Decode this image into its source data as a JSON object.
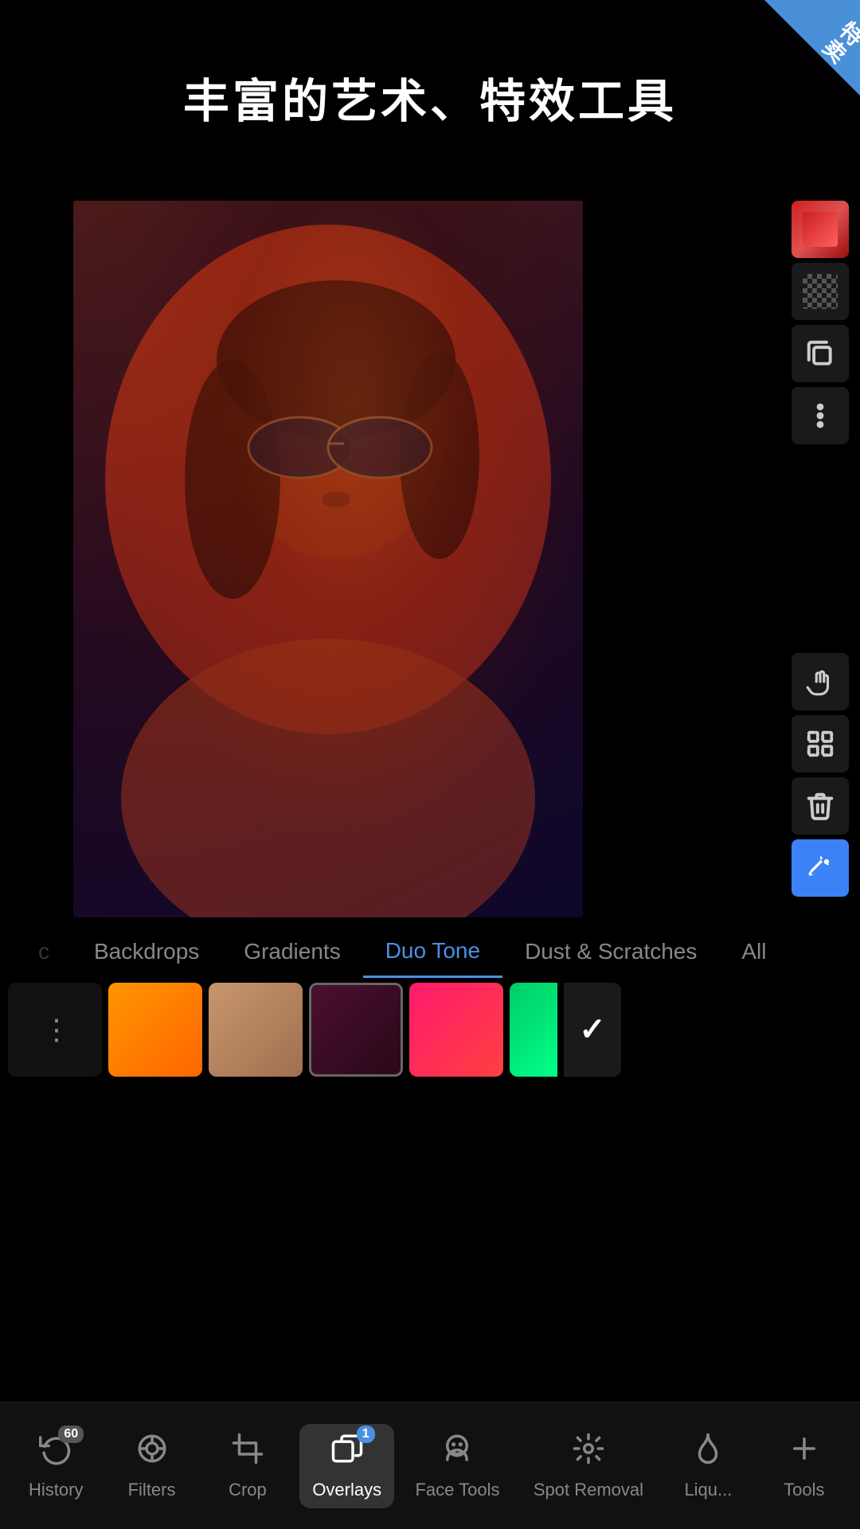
{
  "app": {
    "title": "丰富的艺术、特效工具",
    "corner_badge": "特卖"
  },
  "toolbar": {
    "color_swatch_label": "color swatch",
    "checkerboard_label": "checkerboard",
    "copy_label": "copy",
    "more_label": "more",
    "hand_label": "move",
    "select_label": "select",
    "delete_label": "delete",
    "eyedropper_label": "eyedropper"
  },
  "categories": {
    "items": [
      {
        "id": "backdrops",
        "label": "Backdrops",
        "active": false,
        "partial": false
      },
      {
        "id": "gradients",
        "label": "Gradients",
        "active": false,
        "partial": false
      },
      {
        "id": "duo-tone",
        "label": "Duo Tone",
        "active": true,
        "partial": false
      },
      {
        "id": "dust-scratches",
        "label": "Dust & Scratches",
        "active": false,
        "partial": false
      },
      {
        "id": "all",
        "label": "All",
        "active": false,
        "partial": false
      }
    ]
  },
  "swatches": {
    "items": [
      {
        "id": "more",
        "type": "more"
      },
      {
        "id": "orange",
        "type": "orange"
      },
      {
        "id": "tan",
        "type": "tan"
      },
      {
        "id": "dark-red",
        "type": "dark-red",
        "selected": true
      },
      {
        "id": "pink-red",
        "type": "pink-red"
      },
      {
        "id": "green-partial",
        "type": "green-partial"
      }
    ],
    "check_label": "✓"
  },
  "bottom_nav": {
    "items": [
      {
        "id": "history",
        "label": "History",
        "icon": "history",
        "badge": "60",
        "active": false
      },
      {
        "id": "filters",
        "label": "Filters",
        "icon": "filters",
        "badge": null,
        "active": false
      },
      {
        "id": "crop",
        "label": "Crop",
        "icon": "crop",
        "badge": null,
        "active": false
      },
      {
        "id": "overlays",
        "label": "Overlays",
        "icon": "overlays",
        "badge": "1",
        "active": true
      },
      {
        "id": "face-tools",
        "label": "Face Tools",
        "icon": "face",
        "badge": null,
        "active": false
      },
      {
        "id": "spot-removal",
        "label": "Spot Removal",
        "icon": "spot",
        "badge": null,
        "active": false
      },
      {
        "id": "liquify",
        "label": "Liqu...",
        "icon": "liquify",
        "badge": null,
        "active": false
      },
      {
        "id": "tools",
        "label": "Tools",
        "icon": "tools",
        "badge": null,
        "active": false
      }
    ]
  }
}
